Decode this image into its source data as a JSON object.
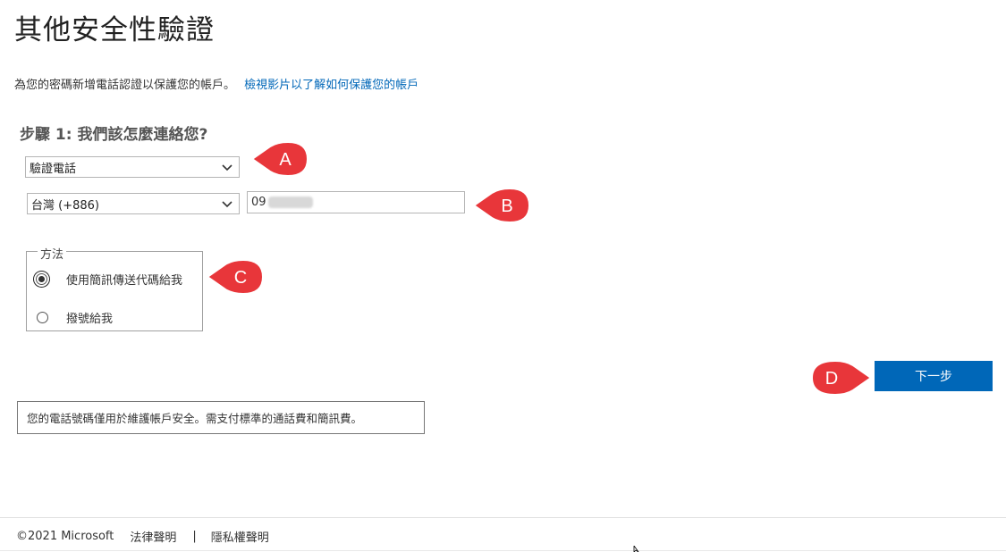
{
  "page": {
    "title": "其他安全性驗證",
    "intro_text": "為您的密碼新增電話認證以保護您的帳戶。",
    "intro_link": "檢視影片以了解如何保護您的帳戶"
  },
  "step": {
    "heading": "步驟 1: 我們該怎麼連絡您?",
    "method_select_value": "驗證電話",
    "country_select_value": "台灣 (+886)",
    "phone_value_visible": "09"
  },
  "method": {
    "legend": "方法",
    "options": [
      {
        "label": "使用簡訊傳送代碼給我",
        "selected": true
      },
      {
        "label": "撥號給我",
        "selected": false
      }
    ]
  },
  "actions": {
    "next_label": "下一步"
  },
  "notice": "您的電話號碼僅用於維護帳戶安全。需支付標準的通話費和簡訊費。",
  "footer": {
    "copyright": "©2021 Microsoft",
    "legal": "法律聲明",
    "separator": "|",
    "privacy": "隱私權聲明"
  },
  "callouts": [
    "A",
    "B",
    "C",
    "D"
  ],
  "colors": {
    "accent": "#0067b8",
    "callout": "#e8363a"
  }
}
